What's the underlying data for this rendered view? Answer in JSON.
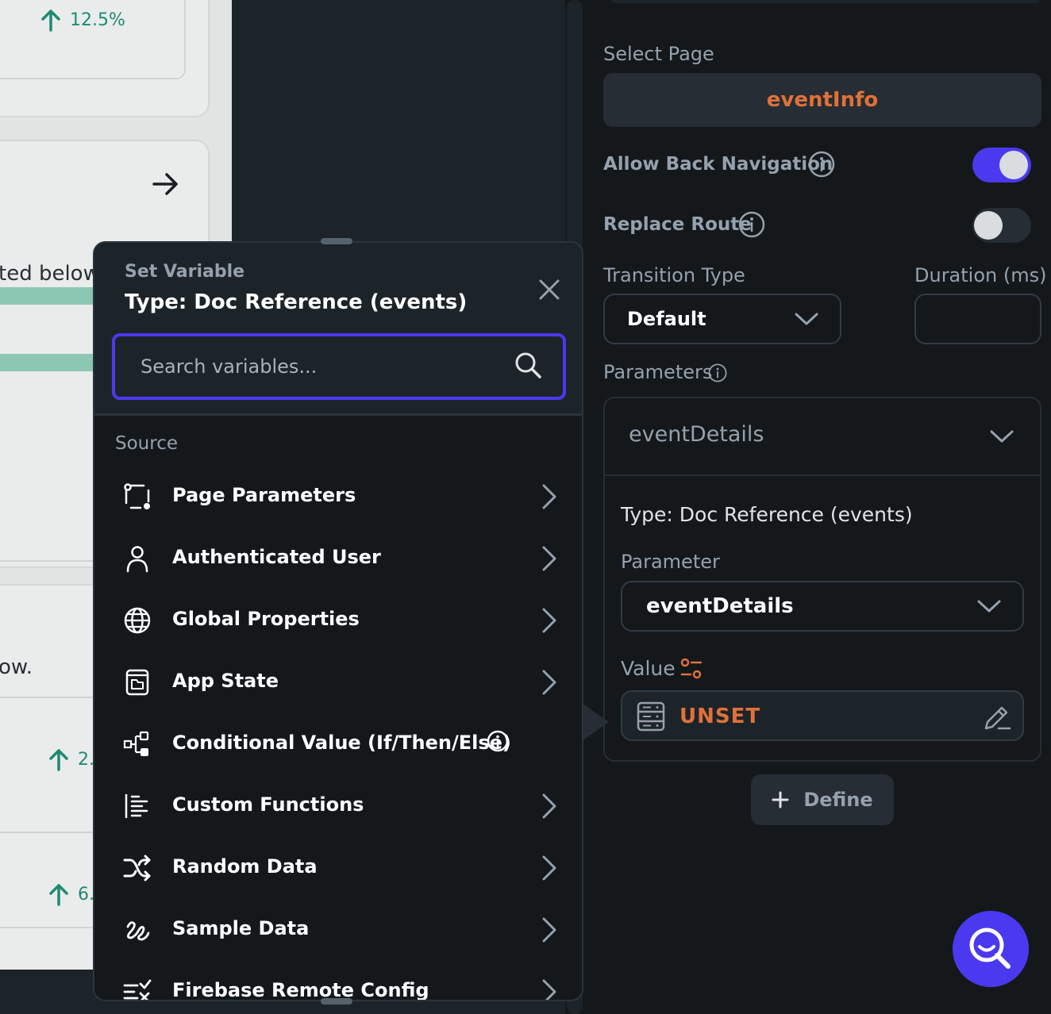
{
  "canvas": {
    "stat_top": "12.5%",
    "text_fragment_1": "ted below.",
    "text_fragment_2": "ow.",
    "stat_mid": "2.",
    "stat_low": "6."
  },
  "properties": {
    "select_page_label": "Select Page",
    "selected_page": "eventInfo",
    "allow_back_label": "Allow Back Navigation",
    "allow_back_on": true,
    "replace_route_label": "Replace Route",
    "replace_route_on": false,
    "transition_type_label": "Transition Type",
    "transition_type_value": "Default",
    "duration_label": "Duration (ms)",
    "duration_value": "",
    "parameters_label": "Parameters",
    "parameter_group": {
      "name": "eventDetails",
      "type_text": "Type: Doc Reference (events)",
      "parameter_label": "Parameter",
      "parameter_value": "eventDetails",
      "value_label": "Value",
      "value_state": "UNSET"
    },
    "define_button": "Define"
  },
  "popup": {
    "subtitle": "Set Variable",
    "title": "Type: Doc Reference (events)",
    "search_placeholder": "Search variables...",
    "source_label": "Source",
    "items": [
      {
        "label": "Page Parameters",
        "icon": "page-parameters-icon",
        "chevron": true
      },
      {
        "label": "Authenticated User",
        "icon": "user-icon",
        "chevron": true
      },
      {
        "label": "Global Properties",
        "icon": "globe-icon",
        "chevron": true
      },
      {
        "label": "App State",
        "icon": "app-state-icon",
        "chevron": true
      },
      {
        "label": "Conditional Value (If/Then/Else)",
        "icon": "conditional-icon",
        "chevron": false,
        "info": true
      },
      {
        "label": "Custom Functions",
        "icon": "custom-functions-icon",
        "chevron": true
      },
      {
        "label": "Random Data",
        "icon": "shuffle-icon",
        "chevron": true
      },
      {
        "label": "Sample Data",
        "icon": "sample-data-icon",
        "chevron": true
      },
      {
        "label": "Firebase Remote Config",
        "icon": "remote-config-icon",
        "chevron": true
      }
    ]
  },
  "colors": {
    "accent": "#4b39ef",
    "orange": "#e0713a",
    "panel_bg": "#14181b",
    "secondary_text": "#95a1ac"
  }
}
